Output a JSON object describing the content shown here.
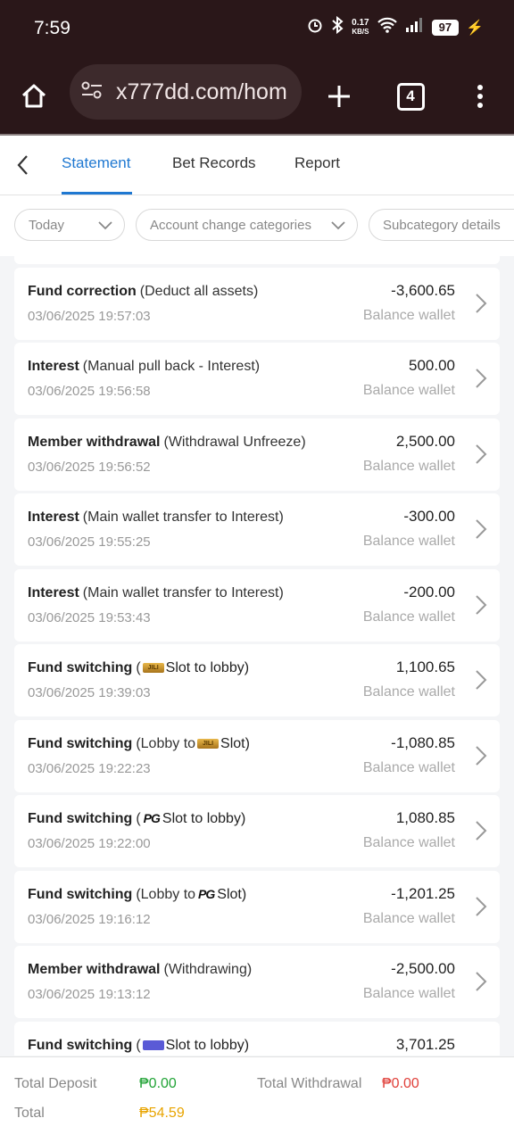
{
  "status_bar": {
    "time": "7:59",
    "net_speed_value": "0.17",
    "net_speed_unit": "KB/S",
    "battery": "97"
  },
  "browser": {
    "url": "x777dd.com/hom",
    "tab_count": "4"
  },
  "nav": {
    "tabs": [
      "Statement",
      "Bet Records",
      "Report"
    ],
    "active_tab": "Statement"
  },
  "filters": {
    "date": "Today",
    "category": "Account change categories",
    "subcategory": "Subcategory details"
  },
  "records": [
    {
      "type": "Fund correction",
      "pre": "(Deduct all assets)",
      "logo": "",
      "post": "",
      "time": "03/06/2025 19:57:03",
      "amount": "-3,600.65",
      "wallet": "Balance wallet"
    },
    {
      "type": "Interest",
      "pre": "(Manual pull back - Interest)",
      "logo": "",
      "post": "",
      "time": "03/06/2025 19:56:58",
      "amount": "500.00",
      "wallet": "Balance wallet"
    },
    {
      "type": "Member withdrawal",
      "pre": "(Withdrawal Unfreeze)",
      "logo": "",
      "post": "",
      "time": "03/06/2025 19:56:52",
      "amount": "2,500.00",
      "wallet": "Balance wallet"
    },
    {
      "type": "Interest",
      "pre": "(Main wallet transfer to Interest)",
      "logo": "",
      "post": "",
      "time": "03/06/2025 19:55:25",
      "amount": "-300.00",
      "wallet": "Balance wallet"
    },
    {
      "type": "Interest",
      "pre": "(Main wallet transfer to Interest)",
      "logo": "",
      "post": "",
      "time": "03/06/2025 19:53:43",
      "amount": "-200.00",
      "wallet": "Balance wallet"
    },
    {
      "type": "Fund switching",
      "pre": "(",
      "logo": "slot",
      "post": "Slot to lobby)",
      "time": "03/06/2025 19:39:03",
      "amount": "1,100.65",
      "wallet": "Balance wallet"
    },
    {
      "type": "Fund switching",
      "pre": "(Lobby to",
      "logo": "slot",
      "post": "Slot)",
      "time": "03/06/2025 19:22:23",
      "amount": "-1,080.85",
      "wallet": "Balance wallet"
    },
    {
      "type": "Fund switching",
      "pre": "(",
      "logo": "pg",
      "post": "Slot to lobby)",
      "time": "03/06/2025 19:22:00",
      "amount": "1,080.85",
      "wallet": "Balance wallet"
    },
    {
      "type": "Fund switching",
      "pre": "(Lobby to",
      "logo": "pg",
      "post": "Slot)",
      "time": "03/06/2025 19:16:12",
      "amount": "-1,201.25",
      "wallet": "Balance wallet"
    },
    {
      "type": "Member withdrawal",
      "pre": "(Withdrawing)",
      "logo": "",
      "post": "",
      "time": "03/06/2025 19:13:12",
      "amount": "-2,500.00",
      "wallet": "Balance wallet"
    },
    {
      "type": "Fund switching",
      "pre": "(",
      "logo": "other",
      "post": "Slot to lobby)",
      "time": "",
      "amount": "3,701.25",
      "wallet": ""
    }
  ],
  "summary": {
    "total_deposit_label": "Total Deposit",
    "total_deposit": "₱0.00",
    "total_withdrawal_label": "Total Withdrawal",
    "total_withdrawal": "₱0.00",
    "total_label": "Total",
    "total": "₱54.59"
  },
  "colors": {
    "accent": "#1f78d1",
    "deposit": "#21a336",
    "withdrawal": "#e0403a",
    "total": "#e8a400",
    "browser_bar": "#2a1719"
  }
}
